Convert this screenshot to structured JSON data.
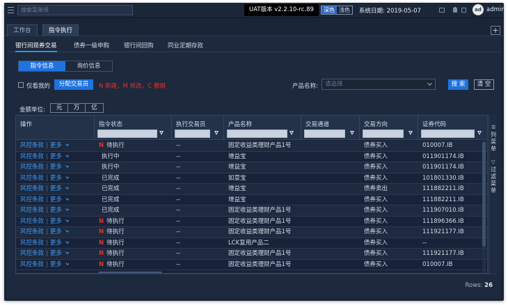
{
  "topbar": {
    "search_placeholder": "搜索菜单项",
    "version": "UAT版本  v2.2.10-rc.89",
    "theme_options": [
      "深色",
      "浅色"
    ],
    "active_theme": "深色",
    "system_date_label": "系统日期:",
    "system_date": "2019-05-07",
    "avatar_text": "ad",
    "username": "admin"
  },
  "page_tabs": [
    {
      "label": "工作台",
      "active": false
    },
    {
      "label": "指令执行",
      "active": true
    }
  ],
  "plus_label": "+",
  "sub_tabs": [
    {
      "label": "银行间现券交易",
      "active": true
    },
    {
      "label": "债券一级申购",
      "active": false
    },
    {
      "label": "银行间回购",
      "active": false
    },
    {
      "label": "同业定期存款",
      "active": false
    }
  ],
  "segments": [
    {
      "label": "指令信息",
      "active": true
    },
    {
      "label": "询价信息",
      "active": false
    }
  ],
  "filters": {
    "only_mine_label": "仅看我的",
    "assign_button": "分配交易员",
    "legend": "N 新建，M 修改，C 撤销",
    "product_label": "产品名称:",
    "product_placeholder": "请选择",
    "search_button": "搜 索",
    "clear_button": "清 空"
  },
  "unit": {
    "label": "金额单位:",
    "options": [
      "元",
      "万",
      "亿"
    ]
  },
  "grid": {
    "columns": [
      "操作",
      "指令状态",
      "执行交易员",
      "产品名称",
      "交易通道",
      "交易方向",
      "证券代码"
    ],
    "action_risk": "风控条款",
    "action_more": "更多",
    "rows": [
      {
        "n": "N",
        "status": "待执行",
        "trader": "--",
        "product": "固定收益类理财产品1号",
        "channel": "",
        "direction": "债券买入",
        "code": "010007.IB"
      },
      {
        "n": "",
        "status": "执行中",
        "trader": "--",
        "product": "增益宝",
        "channel": "",
        "direction": "债券买入",
        "code": "011901174.IB"
      },
      {
        "n": "",
        "status": "执行中",
        "trader": "--",
        "product": "增益宝",
        "channel": "",
        "direction": "债券买入",
        "code": "011901174.IB"
      },
      {
        "n": "",
        "status": "已完成",
        "trader": "--",
        "product": "如意宝",
        "channel": "",
        "direction": "债券买入",
        "code": "101801330.IB"
      },
      {
        "n": "",
        "status": "已完成",
        "trader": "--",
        "product": "增益宝",
        "channel": "",
        "direction": "债券卖出",
        "code": "111882211.IB"
      },
      {
        "n": "",
        "status": "已完成",
        "trader": "--",
        "product": "增益宝",
        "channel": "",
        "direction": "债券买入",
        "code": "111882211.IB"
      },
      {
        "n": "",
        "status": "已完成",
        "trader": "--",
        "product": "固定收益类理财产品1号",
        "channel": "",
        "direction": "债券买入",
        "code": "111907010.IB"
      },
      {
        "n": "N",
        "status": "待执行",
        "trader": "--",
        "product": "固定收益类理财产品1号",
        "channel": "",
        "direction": "债券买入",
        "code": "111896366.IB"
      },
      {
        "n": "N",
        "status": "待执行",
        "trader": "--",
        "product": "固定收益类理财产品1号",
        "channel": "",
        "direction": "债券买入",
        "code": "111921177.IB"
      },
      {
        "n": "N",
        "status": "待执行",
        "trader": "--",
        "product": "LCK复用产品二",
        "channel": "",
        "direction": "债券买入",
        "code": "--"
      },
      {
        "n": "N",
        "status": "待执行",
        "trader": "--",
        "product": "固定收益类理财产品1号",
        "channel": "",
        "direction": "债券买入",
        "code": "111921177.IB"
      },
      {
        "n": "N",
        "status": "待执行",
        "trader": "--",
        "product": "固定收益类理财产品1号",
        "channel": "",
        "direction": "债券买入",
        "code": "010007.IB"
      }
    ]
  },
  "side_panel": {
    "columns_label": "列菜单",
    "filter_label": "过滤菜单"
  },
  "footer": {
    "rows_label": "Rows:",
    "rows_count": "26"
  }
}
